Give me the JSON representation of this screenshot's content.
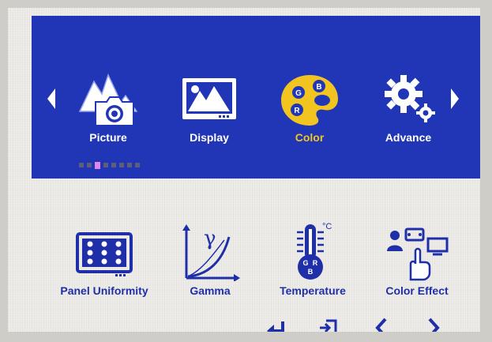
{
  "osd": {
    "main_menu": [
      {
        "label": "Picture",
        "icon": "picture-icon",
        "active": false
      },
      {
        "label": "Display",
        "icon": "display-icon",
        "active": false
      },
      {
        "label": "Color",
        "icon": "color-palette-icon",
        "active": true
      },
      {
        "label": "Advance",
        "icon": "gears-icon",
        "active": false
      }
    ],
    "submenu": [
      {
        "label": "Panel Uniformity",
        "icon": "panel-uniformity-icon"
      },
      {
        "label": "Gamma",
        "icon": "gamma-curve-icon"
      },
      {
        "label": "Temperature",
        "icon": "thermometer-icon"
      },
      {
        "label": "Color Effect",
        "icon": "color-effect-icon"
      }
    ],
    "page_indicator": {
      "total": 8,
      "current": 3
    },
    "nav_keys": [
      "enter-icon",
      "exit-icon",
      "chevron-left-icon",
      "chevron-right-icon"
    ],
    "palette_letters": [
      "B",
      "G",
      "R"
    ],
    "temperature_unit": "°C",
    "thermometer_letters": [
      "G",
      "R",
      "B"
    ],
    "gamma_symbol": "γ"
  },
  "colors": {
    "band": "#2136b6",
    "accent_yellow": "#f2c420",
    "icon_blue": "#1f2fa8",
    "screen_bg": "#eceae6"
  }
}
